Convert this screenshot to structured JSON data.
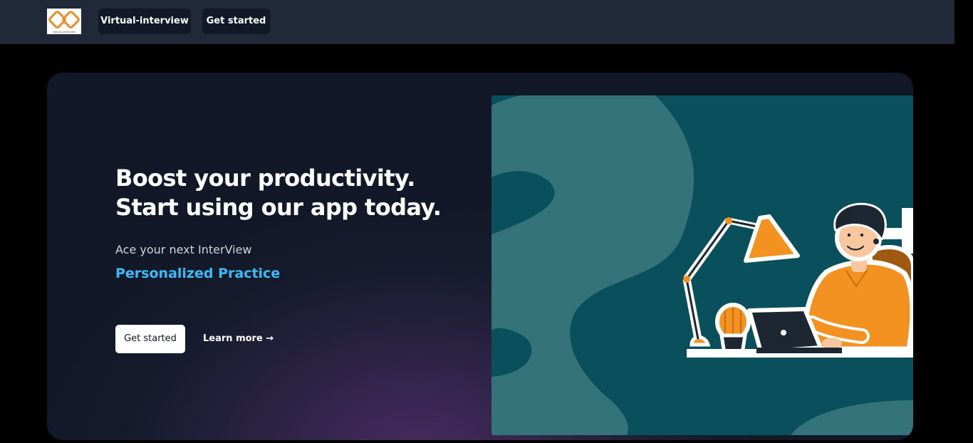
{
  "header": {
    "logo_text": "VIRTUAL-INTERVIEW",
    "nav": [
      {
        "label": "Virtual-interview"
      },
      {
        "label": "Get started"
      }
    ]
  },
  "hero": {
    "headline_line1": "Boost your productivity.",
    "headline_line2": "Start using our app today.",
    "subtitle": "Ace your next InterView",
    "accent_text": "Personalized Practice",
    "cta_label": "Get started",
    "learn_more_label": "Learn more →"
  },
  "colors": {
    "nav_background": "#1f2937",
    "button_background": "#111827",
    "accent": "#38bdf8",
    "illustration_teal": "#0a4f5c",
    "illustration_orange": "#f39220"
  },
  "illustration": {
    "icon": "person-at-desk-with-laptop-and-lamp-illustration"
  }
}
